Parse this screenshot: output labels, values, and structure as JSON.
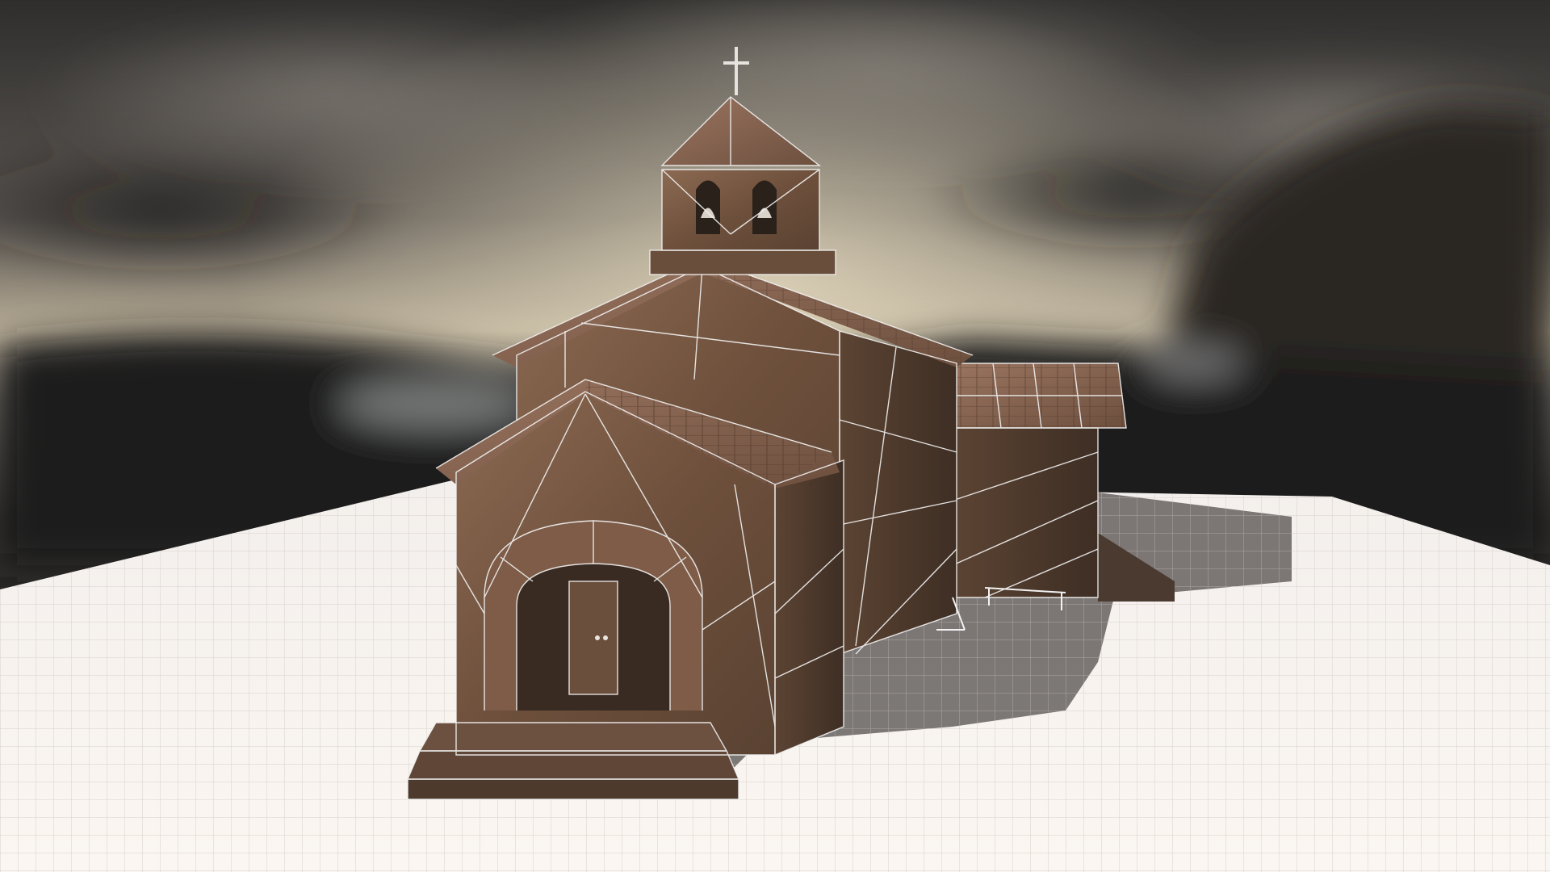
{
  "scene": {
    "subject": "chapel-3d-model",
    "render_mode": "textured-wireframe",
    "colors": {
      "sky_dark": "#3d3b38",
      "sky_light": "#b8ad98",
      "horizon_glow": "#d8cdb2",
      "ground_plane": "#f4efea",
      "grid_line": "#cfc8c2",
      "stone": "#7a5a44",
      "stone_dark": "#4e3a2c",
      "roof_tile": "#8a6550",
      "wire": "#f2f2f2",
      "shadow": "#6e6a68"
    }
  }
}
